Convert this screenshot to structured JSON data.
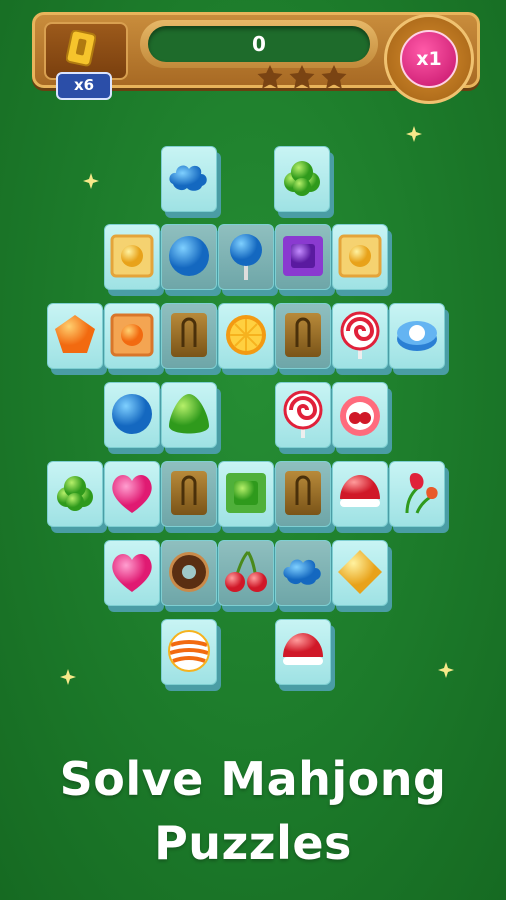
{
  "hud": {
    "hint_count": "x6",
    "score": "0",
    "multiplier": "x1",
    "stars_total": 3,
    "stars_earned": 0
  },
  "headline": {
    "line1": "Solve Mahjong",
    "line2": "Puzzles"
  },
  "tiles": [
    "blue-cloud-candy",
    "green-clover-candy",
    "yellow-wrapped-candy",
    "blue-ball-candy",
    "blue-lollipop",
    "purple-wrapped-candy",
    "yellow-wrapped-candy",
    "orange-pentagon-candy",
    "orange-wrapped-candy",
    "chocolate-bar",
    "orange-slice-candy",
    "chocolate-bar",
    "red-swirl-lollipop",
    "blue-mint-candy",
    "blue-ball-candy",
    "green-gumdrop",
    "red-swirl-lollipop",
    "cherry-cake",
    "green-clover-candy",
    "pink-heart-candy",
    "chocolate-bar",
    "green-wrapped-candy",
    "chocolate-bar",
    "red-jelly-candy",
    "tulip-flowers",
    "pink-heart-candy",
    "chocolate-donut",
    "cherries",
    "blue-cloud-candy",
    "yellow-diamond-candy",
    "orange-striped-candy",
    "red-jelly-candy"
  ]
}
